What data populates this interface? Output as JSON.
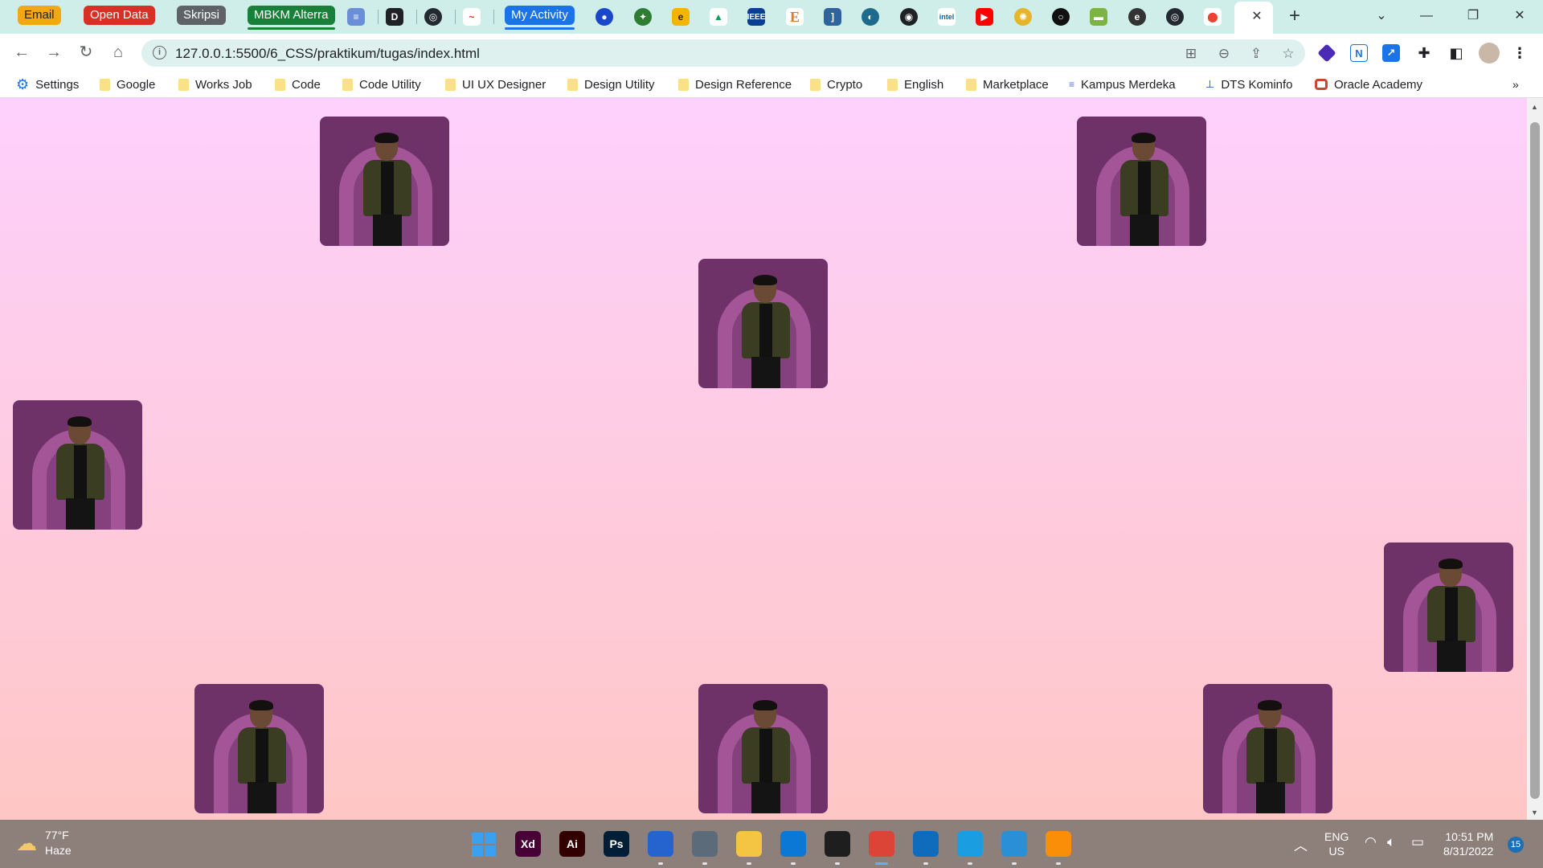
{
  "tab_groups": [
    {
      "label": "Email",
      "color": "#f3a712"
    },
    {
      "label": "Open Data",
      "color": "#d93025"
    },
    {
      "label": "Skripsi",
      "color": "#5f6368"
    },
    {
      "label": "MBKM Alterra",
      "color": "#188038"
    },
    {
      "label": "My Activity",
      "color": "#1a73e8"
    }
  ],
  "address_bar": {
    "url": "127.0.0.1:5500/6_CSS/praktikum/tugas/index.html"
  },
  "bookmarks": [
    {
      "label": "Settings",
      "icon": "gear-icon"
    },
    {
      "label": "Google",
      "icon": "folder-icon"
    },
    {
      "label": "Works Job",
      "icon": "folder-icon"
    },
    {
      "label": "Code",
      "icon": "folder-icon"
    },
    {
      "label": "Code Utility",
      "icon": "folder-icon"
    },
    {
      "label": "UI UX Designer",
      "icon": "folder-icon"
    },
    {
      "label": "Design Utility",
      "icon": "folder-icon"
    },
    {
      "label": "Design Reference",
      "icon": "folder-icon"
    },
    {
      "label": "Crypto",
      "icon": "folder-icon"
    },
    {
      "label": "English",
      "icon": "folder-icon"
    },
    {
      "label": "Marketplace",
      "icon": "folder-icon"
    },
    {
      "label": "Kampus Merdeka",
      "icon": "kampus-merdeka-icon"
    },
    {
      "label": "DTS Kominfo",
      "icon": "dts-icon"
    },
    {
      "label": "Oracle Academy",
      "icon": "oracle-icon"
    }
  ],
  "page": {
    "background_top": "#fed0fd",
    "background_bottom": "#fec7c5",
    "card_color": "#6e3168",
    "photo_count": 8
  },
  "taskbar": {
    "weather": {
      "temp": "77°F",
      "condition": "Haze"
    },
    "language": {
      "line1": "ENG",
      "line2": "US"
    },
    "clock": {
      "time": "10:51 PM",
      "date": "8/31/2022"
    },
    "notifications": "15",
    "apps": [
      {
        "label": "",
        "icon": "windows-start-icon",
        "color": "#3aa0ef"
      },
      {
        "label": "Xd",
        "icon": "adobe-xd-icon",
        "color": "#470137"
      },
      {
        "label": "Ai",
        "icon": "adobe-illustrator-icon",
        "color": "#330000"
      },
      {
        "label": "Ps",
        "icon": "adobe-photoshop-icon",
        "color": "#001e36"
      },
      {
        "label": "",
        "icon": "todo-icon",
        "color": "#2564cf"
      },
      {
        "label": "",
        "icon": "settings-icon",
        "color": "#5b6b7a"
      },
      {
        "label": "",
        "icon": "file-explorer-icon",
        "color": "#f4c542"
      },
      {
        "label": "",
        "icon": "vscode-icon",
        "color": "#0a78d4"
      },
      {
        "label": "",
        "icon": "figma-icon",
        "color": "#1e1e1e"
      },
      {
        "label": "",
        "icon": "chrome-icon",
        "color": "#db4437"
      },
      {
        "label": "",
        "icon": "calendar-icon",
        "color": "#0f6cbd"
      },
      {
        "label": "",
        "icon": "edge-icon",
        "color": "#1b9de2"
      },
      {
        "label": "",
        "icon": "notepad-icon",
        "color": "#2b8fd6"
      },
      {
        "label": "",
        "icon": "sublime-icon",
        "color": "#f98e09"
      }
    ]
  }
}
